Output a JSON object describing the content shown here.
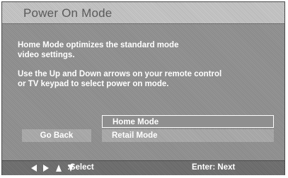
{
  "title": "Power On Mode",
  "description": {
    "line1": "Home Mode optimizes the standard mode\nvideo settings.",
    "line2": "Use the Up and Down arrows on your remote control\nor TV keypad to select power on mode."
  },
  "buttons": {
    "go_back": "Go Back"
  },
  "options": [
    {
      "label": "Home Mode",
      "selected": true
    },
    {
      "label": "Retail Mode",
      "selected": false
    }
  ],
  "footer": {
    "arrow_icons": [
      "left-arrow-icon",
      "right-arrow-icon",
      "up-arrow-icon",
      "down-arrow-icon"
    ],
    "select_hint": ":Select",
    "enter_hint": "Enter: Next"
  },
  "colors": {
    "background": "#8c8c8c",
    "title_bar": "#bdbdbd",
    "text": "#ffffff"
  }
}
